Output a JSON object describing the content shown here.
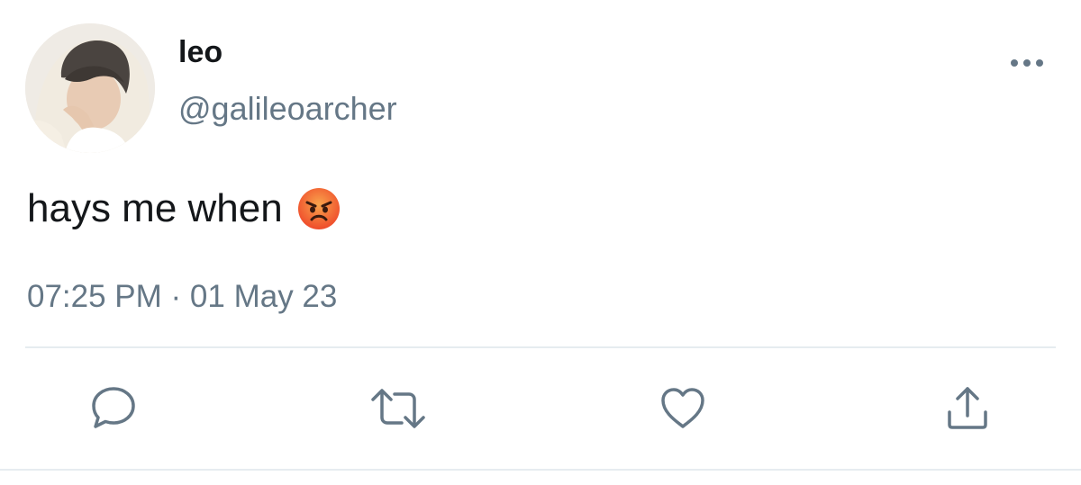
{
  "tweet": {
    "author": {
      "name": "leo",
      "handle": "@galileoarcher",
      "avatar_icon": "profile-photo"
    },
    "text": "hays me when",
    "emoji": "angry-face",
    "timestamp": "07:25 PM · 01 May 23"
  },
  "actions": [
    {
      "name": "reply",
      "icon": "speech-bubble-icon"
    },
    {
      "name": "retweet",
      "icon": "retweet-arrows-icon"
    },
    {
      "name": "like",
      "icon": "heart-icon"
    },
    {
      "name": "share",
      "icon": "share-upload-icon"
    }
  ],
  "colors": {
    "text_primary": "#14171a",
    "text_secondary": "#657786",
    "icon": "#657786",
    "divider": "#e6ecf0"
  }
}
